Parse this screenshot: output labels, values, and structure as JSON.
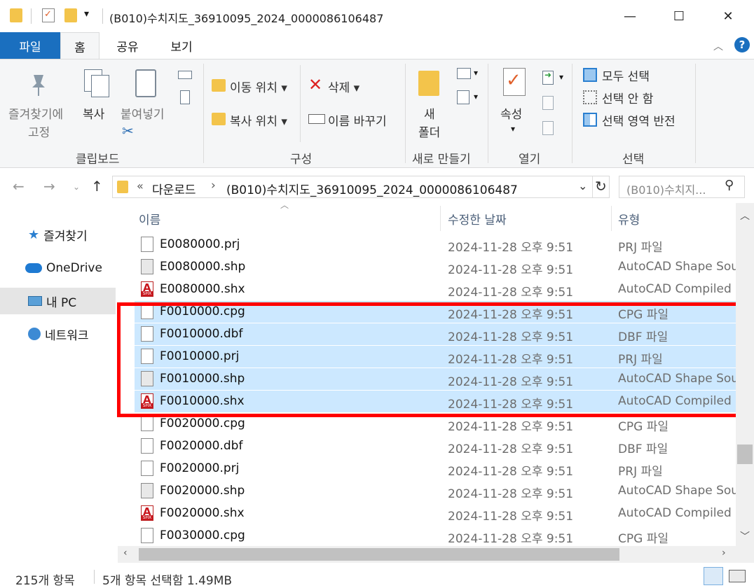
{
  "window": {
    "title": "(B010)수치지도_36910095_2024_0000086106487",
    "qa_dropdown": "▾",
    "minimize": "—",
    "maximize": "☐",
    "close": "✕"
  },
  "tabs": {
    "file": "파일",
    "home": "홈",
    "share": "공유",
    "view": "보기",
    "help": "?"
  },
  "ribbon": {
    "clipboard": {
      "pin_line1": "즐겨찾기에",
      "pin_line2": "고정",
      "copy": "복사",
      "paste": "붙여넣기",
      "label": "클립보드"
    },
    "organize": {
      "move_to": "이동 위치",
      "copy_to": "복사 위치",
      "delete": "삭제",
      "rename": "이름 바꾸기",
      "label": "구성"
    },
    "new": {
      "folder_line1": "새",
      "folder_line2": "폴더",
      "label": "새로 만들기"
    },
    "open": {
      "properties": "속성",
      "label": "열기"
    },
    "select": {
      "select_all": "모두 선택",
      "select_none": "선택 안 함",
      "invert": "선택 영역 반전",
      "label": "선택"
    }
  },
  "address": {
    "prefix": "«",
    "crumb1": "다운로드",
    "arrow": "›",
    "crumb2": "(B010)수치지도_36910095_2024_0000086106487",
    "search_placeholder": "(B010)수치지..."
  },
  "nav_pane": [
    {
      "label": "즐겨찾기",
      "icon": "star-icon"
    },
    {
      "label": "OneDrive",
      "icon": "cloud-icon"
    },
    {
      "label": "내 PC",
      "icon": "pc-icon"
    },
    {
      "label": "네트워크",
      "icon": "network-icon"
    }
  ],
  "columns": {
    "name": "이름",
    "date": "수정한 날짜",
    "type": "유형"
  },
  "files": [
    {
      "name": "E0080000.prj",
      "date": "2024-11-28 오후 9:51",
      "type": "PRJ 파일",
      "icon": "blank",
      "selected": false
    },
    {
      "name": "E0080000.shp",
      "date": "2024-11-28 오후 9:51",
      "type": "AutoCAD Shape Sou",
      "icon": "shp",
      "selected": false
    },
    {
      "name": "E0080000.shx",
      "date": "2024-11-28 오후 9:51",
      "type": "AutoCAD Compiled .",
      "icon": "shx",
      "selected": false
    },
    {
      "name": "F0010000.cpg",
      "date": "2024-11-28 오후 9:51",
      "type": "CPG 파일",
      "icon": "blank",
      "selected": true
    },
    {
      "name": "F0010000.dbf",
      "date": "2024-11-28 오후 9:51",
      "type": "DBF 파일",
      "icon": "blank",
      "selected": true
    },
    {
      "name": "F0010000.prj",
      "date": "2024-11-28 오후 9:51",
      "type": "PRJ 파일",
      "icon": "blank",
      "selected": true
    },
    {
      "name": "F0010000.shp",
      "date": "2024-11-28 오후 9:51",
      "type": "AutoCAD Shape Sou",
      "icon": "shp",
      "selected": true
    },
    {
      "name": "F0010000.shx",
      "date": "2024-11-28 오후 9:51",
      "type": "AutoCAD Compiled .",
      "icon": "shx",
      "selected": true
    },
    {
      "name": "F0020000.cpg",
      "date": "2024-11-28 오후 9:51",
      "type": "CPG 파일",
      "icon": "blank",
      "selected": false
    },
    {
      "name": "F0020000.dbf",
      "date": "2024-11-28 오후 9:51",
      "type": "DBF 파일",
      "icon": "blank",
      "selected": false
    },
    {
      "name": "F0020000.prj",
      "date": "2024-11-28 오후 9:51",
      "type": "PRJ 파일",
      "icon": "blank",
      "selected": false
    },
    {
      "name": "F0020000.shp",
      "date": "2024-11-28 오후 9:51",
      "type": "AutoCAD Shape Sou",
      "icon": "shp",
      "selected": false
    },
    {
      "name": "F0020000.shx",
      "date": "2024-11-28 오후 9:51",
      "type": "AutoCAD Compiled .",
      "icon": "shx",
      "selected": false
    },
    {
      "name": "F0030000.cpg",
      "date": "2024-11-28 오후 9:51",
      "type": "CPG 파일",
      "icon": "blank",
      "selected": false
    }
  ],
  "status": {
    "count": "215개 항목",
    "selection": "5개 항목 선택함 1.49MB"
  },
  "colors": {
    "accent": "#1a6fbf",
    "selection": "#cce8ff",
    "highlight_box": "#ff0000"
  }
}
